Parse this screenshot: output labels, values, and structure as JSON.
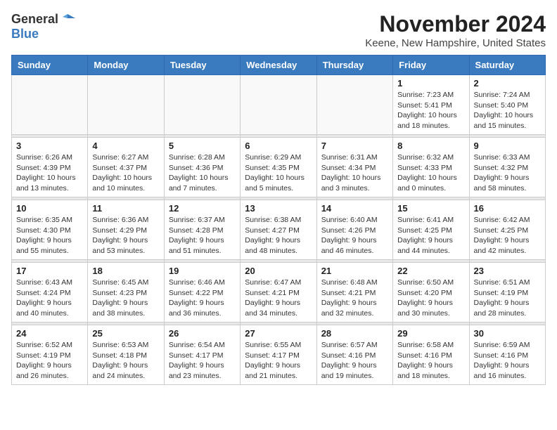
{
  "header": {
    "logo_general": "General",
    "logo_blue": "Blue",
    "month_title": "November 2024",
    "location": "Keene, New Hampshire, United States"
  },
  "days_of_week": [
    "Sunday",
    "Monday",
    "Tuesday",
    "Wednesday",
    "Thursday",
    "Friday",
    "Saturday"
  ],
  "weeks": [
    [
      {
        "day": "",
        "info": ""
      },
      {
        "day": "",
        "info": ""
      },
      {
        "day": "",
        "info": ""
      },
      {
        "day": "",
        "info": ""
      },
      {
        "day": "",
        "info": ""
      },
      {
        "day": "1",
        "info": "Sunrise: 7:23 AM\nSunset: 5:41 PM\nDaylight: 10 hours and 18 minutes."
      },
      {
        "day": "2",
        "info": "Sunrise: 7:24 AM\nSunset: 5:40 PM\nDaylight: 10 hours and 15 minutes."
      }
    ],
    [
      {
        "day": "3",
        "info": "Sunrise: 6:26 AM\nSunset: 4:39 PM\nDaylight: 10 hours and 13 minutes."
      },
      {
        "day": "4",
        "info": "Sunrise: 6:27 AM\nSunset: 4:37 PM\nDaylight: 10 hours and 10 minutes."
      },
      {
        "day": "5",
        "info": "Sunrise: 6:28 AM\nSunset: 4:36 PM\nDaylight: 10 hours and 7 minutes."
      },
      {
        "day": "6",
        "info": "Sunrise: 6:29 AM\nSunset: 4:35 PM\nDaylight: 10 hours and 5 minutes."
      },
      {
        "day": "7",
        "info": "Sunrise: 6:31 AM\nSunset: 4:34 PM\nDaylight: 10 hours and 3 minutes."
      },
      {
        "day": "8",
        "info": "Sunrise: 6:32 AM\nSunset: 4:33 PM\nDaylight: 10 hours and 0 minutes."
      },
      {
        "day": "9",
        "info": "Sunrise: 6:33 AM\nSunset: 4:32 PM\nDaylight: 9 hours and 58 minutes."
      }
    ],
    [
      {
        "day": "10",
        "info": "Sunrise: 6:35 AM\nSunset: 4:30 PM\nDaylight: 9 hours and 55 minutes."
      },
      {
        "day": "11",
        "info": "Sunrise: 6:36 AM\nSunset: 4:29 PM\nDaylight: 9 hours and 53 minutes."
      },
      {
        "day": "12",
        "info": "Sunrise: 6:37 AM\nSunset: 4:28 PM\nDaylight: 9 hours and 51 minutes."
      },
      {
        "day": "13",
        "info": "Sunrise: 6:38 AM\nSunset: 4:27 PM\nDaylight: 9 hours and 48 minutes."
      },
      {
        "day": "14",
        "info": "Sunrise: 6:40 AM\nSunset: 4:26 PM\nDaylight: 9 hours and 46 minutes."
      },
      {
        "day": "15",
        "info": "Sunrise: 6:41 AM\nSunset: 4:25 PM\nDaylight: 9 hours and 44 minutes."
      },
      {
        "day": "16",
        "info": "Sunrise: 6:42 AM\nSunset: 4:25 PM\nDaylight: 9 hours and 42 minutes."
      }
    ],
    [
      {
        "day": "17",
        "info": "Sunrise: 6:43 AM\nSunset: 4:24 PM\nDaylight: 9 hours and 40 minutes."
      },
      {
        "day": "18",
        "info": "Sunrise: 6:45 AM\nSunset: 4:23 PM\nDaylight: 9 hours and 38 minutes."
      },
      {
        "day": "19",
        "info": "Sunrise: 6:46 AM\nSunset: 4:22 PM\nDaylight: 9 hours and 36 minutes."
      },
      {
        "day": "20",
        "info": "Sunrise: 6:47 AM\nSunset: 4:21 PM\nDaylight: 9 hours and 34 minutes."
      },
      {
        "day": "21",
        "info": "Sunrise: 6:48 AM\nSunset: 4:21 PM\nDaylight: 9 hours and 32 minutes."
      },
      {
        "day": "22",
        "info": "Sunrise: 6:50 AM\nSunset: 4:20 PM\nDaylight: 9 hours and 30 minutes."
      },
      {
        "day": "23",
        "info": "Sunrise: 6:51 AM\nSunset: 4:19 PM\nDaylight: 9 hours and 28 minutes."
      }
    ],
    [
      {
        "day": "24",
        "info": "Sunrise: 6:52 AM\nSunset: 4:19 PM\nDaylight: 9 hours and 26 minutes."
      },
      {
        "day": "25",
        "info": "Sunrise: 6:53 AM\nSunset: 4:18 PM\nDaylight: 9 hours and 24 minutes."
      },
      {
        "day": "26",
        "info": "Sunrise: 6:54 AM\nSunset: 4:17 PM\nDaylight: 9 hours and 23 minutes."
      },
      {
        "day": "27",
        "info": "Sunrise: 6:55 AM\nSunset: 4:17 PM\nDaylight: 9 hours and 21 minutes."
      },
      {
        "day": "28",
        "info": "Sunrise: 6:57 AM\nSunset: 4:16 PM\nDaylight: 9 hours and 19 minutes."
      },
      {
        "day": "29",
        "info": "Sunrise: 6:58 AM\nSunset: 4:16 PM\nDaylight: 9 hours and 18 minutes."
      },
      {
        "day": "30",
        "info": "Sunrise: 6:59 AM\nSunset: 4:16 PM\nDaylight: 9 hours and 16 minutes."
      }
    ]
  ]
}
